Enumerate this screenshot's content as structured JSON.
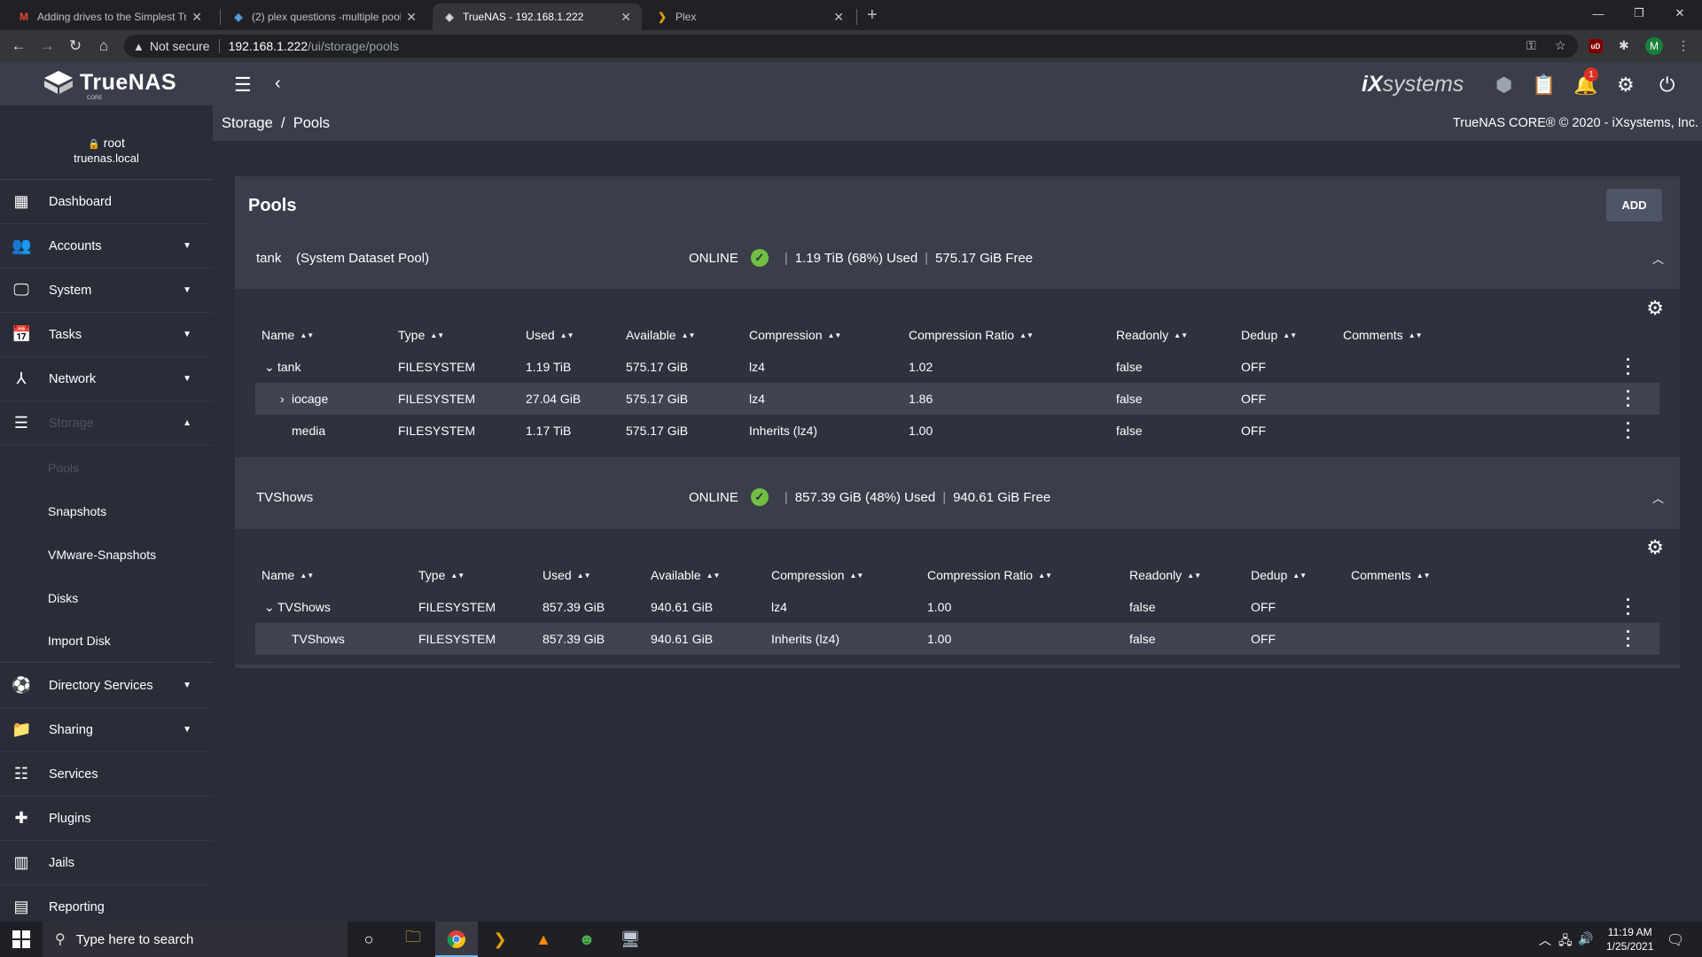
{
  "browser": {
    "tabs": [
      {
        "title": "Adding drives to the Simplest Tru",
        "icon": "gmail-icon"
      },
      {
        "title": "(2) plex questions -multiple pool",
        "icon": "truenas-forum-icon"
      },
      {
        "title": "TrueNAS - 192.168.1.222",
        "icon": "truenas-icon"
      },
      {
        "title": "Plex",
        "icon": "plex-icon"
      }
    ],
    "security_label": "Not secure",
    "url_host": "192.168.1.222",
    "url_path": "/ui/storage/pools",
    "profile_initial": "M",
    "ext_badge": "uD"
  },
  "app": {
    "brand": "TrueNAS",
    "brand_sub": "CORE",
    "vendor_prefix": "iX",
    "vendor": "systems",
    "notification_count": "1"
  },
  "user": {
    "name": "root",
    "host": "truenas.local"
  },
  "sidebar": {
    "items": [
      {
        "label": "Dashboard",
        "icon": "dashboard-icon",
        "caret": ""
      },
      {
        "label": "Accounts",
        "icon": "accounts-icon",
        "caret": "▼"
      },
      {
        "label": "System",
        "icon": "system-icon",
        "caret": "▼"
      },
      {
        "label": "Tasks",
        "icon": "tasks-icon",
        "caret": "▼"
      },
      {
        "label": "Network",
        "icon": "network-icon",
        "caret": "▼"
      },
      {
        "label": "Storage",
        "icon": "storage-icon",
        "caret": "▲"
      }
    ],
    "storage_sub": [
      "Pools",
      "Snapshots",
      "VMware-Snapshots",
      "Disks",
      "Import Disk"
    ],
    "items2": [
      {
        "label": "Directory Services",
        "icon": "directory-services-icon",
        "caret": "▼"
      },
      {
        "label": "Sharing",
        "icon": "sharing-icon",
        "caret": "▼"
      },
      {
        "label": "Services",
        "icon": "services-icon",
        "caret": ""
      },
      {
        "label": "Plugins",
        "icon": "plugins-icon",
        "caret": ""
      },
      {
        "label": "Jails",
        "icon": "jails-icon",
        "caret": ""
      },
      {
        "label": "Reporting",
        "icon": "reporting-icon",
        "caret": ""
      }
    ]
  },
  "breadcrumb": {
    "root": "Storage",
    "sep": "/",
    "current": "Pools"
  },
  "copyright": "TrueNAS CORE® © 2020 - iXsystems, Inc.",
  "card": {
    "title": "Pools",
    "add_label": "ADD"
  },
  "columns": [
    "Name",
    "Type",
    "Used",
    "Available",
    "Compression",
    "Compression Ratio",
    "Readonly",
    "Dedup",
    "Comments"
  ],
  "pools": [
    {
      "name": "tank",
      "tag": "(System Dataset Pool)",
      "status": "ONLINE",
      "used": "1.19 TiB (68%) Used",
      "free": "575.17 GiB Free",
      "rows": [
        {
          "name": "tank",
          "expander": "⌄",
          "type": "FILESYSTEM",
          "used": "1.19 TiB",
          "available": "575.17 GiB",
          "compression": "lz4",
          "ratio": "1.02",
          "readonly": "false",
          "dedup": "OFF",
          "comments": ""
        },
        {
          "name": "iocage",
          "expander": "›",
          "type": "FILESYSTEM",
          "used": "27.04 GiB",
          "available": "575.17 GiB",
          "compression": "lz4",
          "ratio": "1.86",
          "readonly": "false",
          "dedup": "OFF",
          "comments": ""
        },
        {
          "name": "media",
          "expander": "",
          "type": "FILESYSTEM",
          "used": "1.17 TiB",
          "available": "575.17 GiB",
          "compression": "Inherits (lz4)",
          "ratio": "1.00",
          "readonly": "false",
          "dedup": "OFF",
          "comments": ""
        }
      ]
    },
    {
      "name": "TVShows",
      "tag": "",
      "status": "ONLINE",
      "used": "857.39 GiB (48%) Used",
      "free": "940.61 GiB Free",
      "rows": [
        {
          "name": "TVShows",
          "expander": "⌄",
          "type": "FILESYSTEM",
          "used": "857.39 GiB",
          "available": "940.61 GiB",
          "compression": "lz4",
          "ratio": "1.00",
          "readonly": "false",
          "dedup": "OFF",
          "comments": ""
        },
        {
          "name": "TVShows",
          "expander": "",
          "type": "FILESYSTEM",
          "used": "857.39 GiB",
          "available": "940.61 GiB",
          "compression": "Inherits (lz4)",
          "ratio": "1.00",
          "readonly": "false",
          "dedup": "OFF",
          "comments": ""
        }
      ]
    }
  ],
  "taskbar": {
    "search_placeholder": "Type here to search",
    "time": "11:19 AM",
    "date": "1/25/2021"
  }
}
